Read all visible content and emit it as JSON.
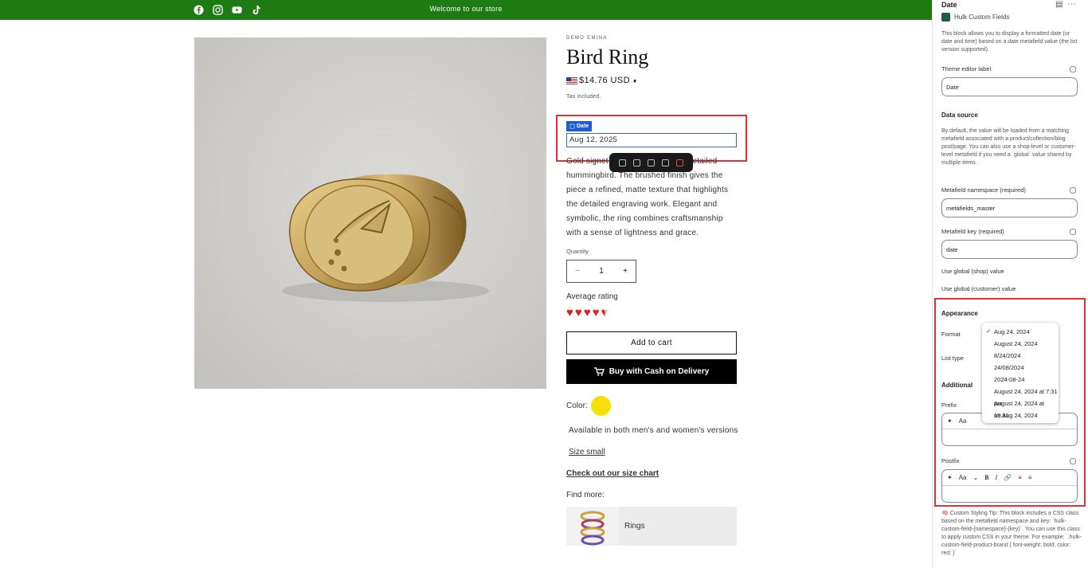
{
  "announcement": {
    "text": "Welcome to our store",
    "socials": [
      "facebook-icon",
      "instagram-icon",
      "youtube-icon",
      "tiktok-icon"
    ]
  },
  "product": {
    "vendor": "DEMO EMINA",
    "title": "Bird Ring",
    "price": "$14.76 USD",
    "currency_caret": "♦",
    "tax_note": "Tax included.",
    "date_block_label": "Date",
    "date_value": "Aug 12, 2025",
    "description": "Gold signet ring engraved with a detailed hummingbird. The brushed finish gives the piece a refined, matte texture that highlights the detailed engraving work. Elegant and symbolic, the ring combines craftsmanship with a sense of lightness and grace.",
    "quantity_label": "Quantity",
    "quantity_value": "1",
    "qty_minus": "−",
    "qty_plus": "+",
    "rating_label": "Average rating",
    "rating_value": 4.5,
    "rating_max": 5,
    "add_to_cart": "Add to cart",
    "buy_cod": "Buy with Cash on Delivery",
    "color_label": "Color:",
    "color_swatch": "#f5e000",
    "availability": "Available in both men's and women's versions",
    "size_link": "Size small",
    "size_chart": "Check out our size chart",
    "find_more": "Find more:",
    "collection_card": "Rings"
  },
  "panel": {
    "title": "Date",
    "app_name": "Hulk Custom Fields",
    "intro": "This block allows you to display a formatted date (or date and time) based on a date metafield value (the list version supported).",
    "theme_editor_label": "Theme editor label",
    "theme_editor_value": "Date",
    "data_source_title": "Data source",
    "data_source_text": "By default, the value will be loaded from a matching metafield associated with a product/collection/blog post/page. You can also use a shop-level or customer-level metafield if you need a `global` value shared by multiple items.",
    "namespace_label": "Metafield namespace (required)",
    "namespace_value": "metafields_master",
    "key_label": "Metafield key (required)",
    "key_value": "date",
    "global_shop_label": "Use global (shop) value",
    "global_customer_label": "Use global (customer) value",
    "appearance_title": "Appearance",
    "format_label": "Format",
    "list_type_label": "List type",
    "additional_title": "Additional",
    "prefix_label": "Prefix",
    "postfix_label": "Postfix",
    "format_options": [
      "Aug 24, 2024",
      "August 24, 2024",
      "8/24/2024",
      "24/08/2024",
      "2024-08-24",
      "August 24, 2024 at 7:31 pm",
      "August 24, 2024 at 19:31",
      "on Aug 24, 2024"
    ],
    "format_selected": "Aug 24, 2024",
    "rte_font": "Aa",
    "rte_bold": "B",
    "rte_italic": "I",
    "tip": "🧠 Custom Styling Tip: This block includes a CSS class based on the metafield namespace and key: `hulk-custom-field-{namespace}-{key}`. You can use this class to apply custom CSS in your theme. For example: `.hulk-custom-field-product-brand { font-weight: bold; color: red; }`"
  }
}
